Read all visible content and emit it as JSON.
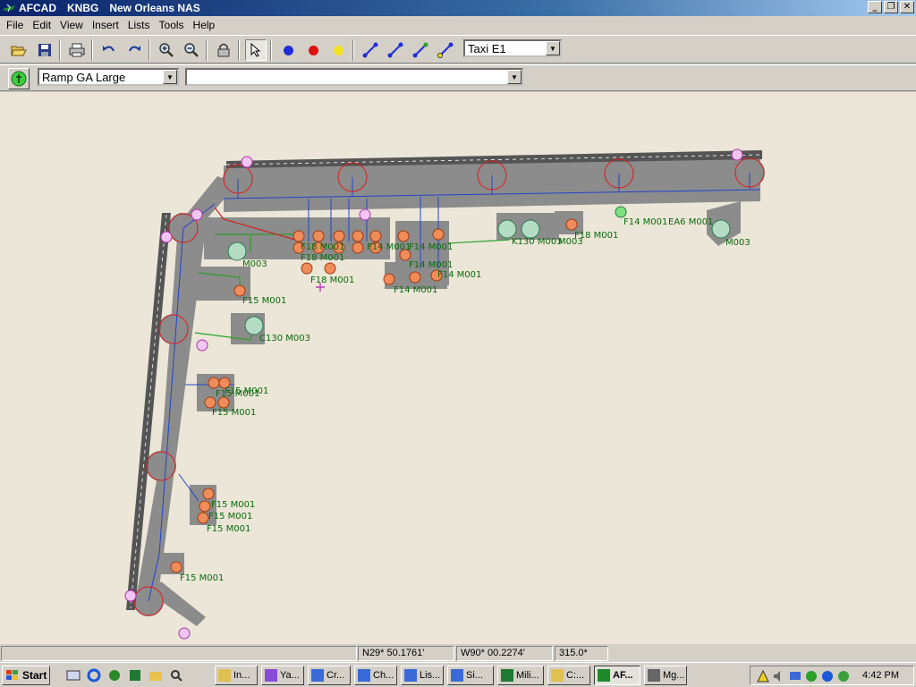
{
  "window": {
    "app": "AFCAD",
    "airport_code": "KNBG",
    "airport_name": "New Orleans NAS"
  },
  "menu": [
    "File",
    "Edit",
    "View",
    "Insert",
    "Lists",
    "Tools",
    "Help"
  ],
  "toolbar": {
    "taxi_type": "Taxi E1"
  },
  "toolbar2": {
    "parking_type": "Ramp GA Large",
    "name_value": ""
  },
  "map": {
    "labels": [
      "M003",
      "F15 M001",
      "C130 M003",
      "F15 M001",
      "F15 M001",
      "F15 M001",
      "F15 M001",
      "F15 M001",
      "F15 M001",
      "F15 M001",
      "F18 M001",
      "F18 M001",
      "F18 M001",
      "F14 M001",
      "F14 M001",
      "F14 M001",
      "F14 M001",
      "F14 M001",
      "K130 M003",
      "M003",
      "F18 M001",
      "F14 M001",
      "EA6 M001",
      "M003"
    ]
  },
  "status": {
    "lat": "N29* 50.1761'",
    "lon": "W90* 00.2274'",
    "heading": "315.0*"
  },
  "taskbar": {
    "start": "Start",
    "tasks": [
      "In...",
      "Ya...",
      "Cr...",
      "Ch...",
      "Lis...",
      "Si...",
      "Mili...",
      "C:...",
      "AF...",
      "Mg..."
    ],
    "clock": "4:42 PM"
  },
  "colors": {
    "title_bar": "#0a246a",
    "canvas": "#ebe6d7",
    "taxiway": "#8c8c8c",
    "runway": "#555555",
    "node": "#2244cc",
    "label": "#0a6a0a"
  }
}
